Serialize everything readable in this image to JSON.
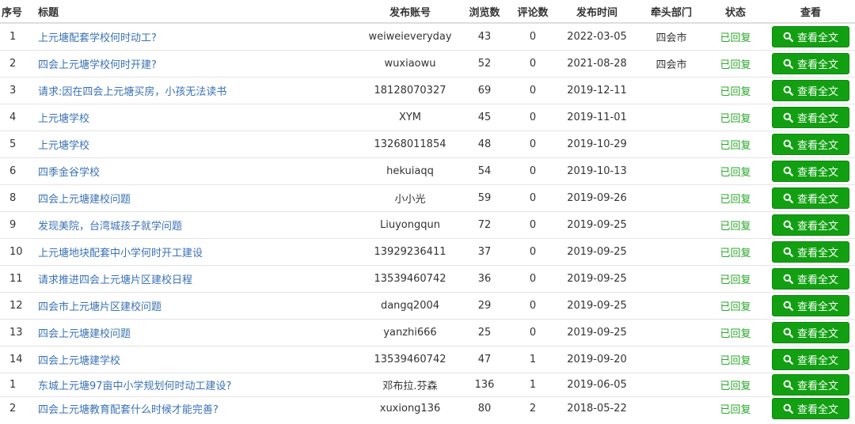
{
  "columns": {
    "index": "序号",
    "title": "标题",
    "account": "发布账号",
    "views": "浏览数",
    "comments": "评论数",
    "date": "发布时间",
    "dept": "牵头部门",
    "status": "状态",
    "action": "查看"
  },
  "view_button_label": "查看全文",
  "icon": "search-icon",
  "colors": {
    "link": "#3a72b5",
    "status": "#2ba52b",
    "button": "#12a012"
  },
  "rows": [
    {
      "index": "1",
      "title": "上元塘配套学校何时动工?",
      "account": "weiweieveryday",
      "views": "43",
      "comments": "0",
      "date": "2022-03-05",
      "dept": "四会市",
      "status": "已回复"
    },
    {
      "index": "2",
      "title": "四会上元塘学校何时开建?",
      "account": "wuxiaowu",
      "views": "52",
      "comments": "0",
      "date": "2021-08-28",
      "dept": "四会市",
      "status": "已回复"
    },
    {
      "index": "3",
      "title": "请求:因在四会上元塘买房，小孩无法读书",
      "account": "18128070327",
      "views": "69",
      "comments": "0",
      "date": "2019-12-11",
      "dept": "",
      "status": "已回复"
    },
    {
      "index": "4",
      "title": "上元塘学校",
      "account": "XYM",
      "views": "45",
      "comments": "0",
      "date": "2019-11-01",
      "dept": "",
      "status": "已回复"
    },
    {
      "index": "5",
      "title": "上元塘学校",
      "account": "13268011854",
      "views": "48",
      "comments": "0",
      "date": "2019-10-29",
      "dept": "",
      "status": "已回复"
    },
    {
      "index": "6",
      "title": "四季金谷学校",
      "account": "hekuiaqq",
      "views": "54",
      "comments": "0",
      "date": "2019-10-13",
      "dept": "",
      "status": "已回复"
    },
    {
      "index": "8",
      "title": "四会上元塘建校问题",
      "account": "小小光",
      "views": "59",
      "comments": "0",
      "date": "2019-09-26",
      "dept": "",
      "status": "已回复"
    },
    {
      "index": "9",
      "title": "发现美院，台湾城孩子就学问题",
      "account": "Liuyongqun",
      "views": "72",
      "comments": "0",
      "date": "2019-09-25",
      "dept": "",
      "status": "已回复"
    },
    {
      "index": "10",
      "title": "上元塘地块配套中小学何时开工建设",
      "account": "13929236411",
      "views": "37",
      "comments": "0",
      "date": "2019-09-25",
      "dept": "",
      "status": "已回复"
    },
    {
      "index": "11",
      "title": "请求推进四会上元塘片区建校日程",
      "account": "13539460742",
      "views": "36",
      "comments": "0",
      "date": "2019-09-25",
      "dept": "",
      "status": "已回复"
    },
    {
      "index": "12",
      "title": "四会市上元塘片区建校问题",
      "account": "dangq2004",
      "views": "29",
      "comments": "0",
      "date": "2019-09-25",
      "dept": "",
      "status": "已回复"
    },
    {
      "index": "13",
      "title": "四会上元塘建校问题",
      "account": "yanzhi666",
      "views": "25",
      "comments": "0",
      "date": "2019-09-25",
      "dept": "",
      "status": "已回复"
    },
    {
      "index": "14",
      "title": "四会上元塘建学校",
      "account": "13539460742",
      "views": "47",
      "comments": "1",
      "date": "2019-09-20",
      "dept": "",
      "status": "已回复"
    },
    {
      "index": "1",
      "title": "东城上元塘97亩中小学规划何时动工建设?",
      "account": "邓布拉.芬森",
      "views": "136",
      "comments": "1",
      "date": "2019-06-05",
      "dept": "",
      "status": "已回复"
    },
    {
      "index": "2",
      "title": "四会上元塘教育配套什么时候才能完善?",
      "account": "xuxiong136",
      "views": "80",
      "comments": "2",
      "date": "2018-05-22",
      "dept": "",
      "status": "已回复"
    }
  ]
}
